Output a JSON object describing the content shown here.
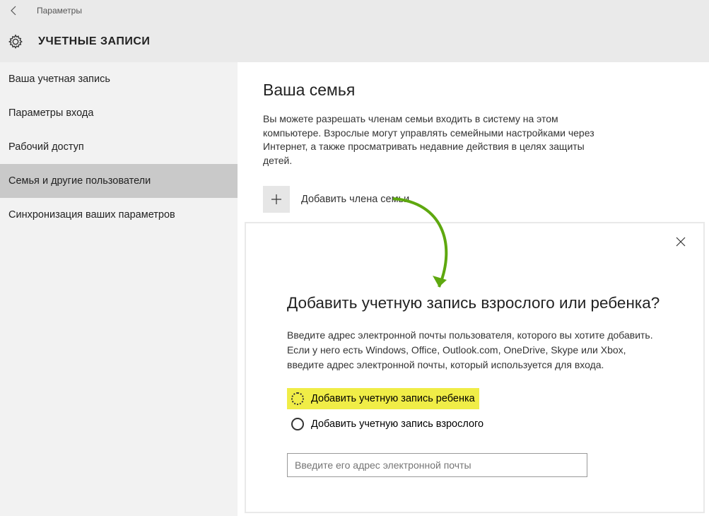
{
  "titlebar": {
    "label": "Параметры"
  },
  "header": {
    "title": "УЧЕТНЫЕ ЗАПИСИ"
  },
  "sidebar": {
    "items": [
      {
        "label": "Ваша учетная запись",
        "selected": false
      },
      {
        "label": "Параметры входа",
        "selected": false
      },
      {
        "label": "Рабочий доступ",
        "selected": false
      },
      {
        "label": "Семья и другие пользователи",
        "selected": true
      },
      {
        "label": "Синхронизация ваших параметров",
        "selected": false
      }
    ]
  },
  "main": {
    "section_title": "Ваша семья",
    "section_desc": "Вы можете разрешать членам семьи входить в систему на этом компьютере. Взрослые могут управлять семейными настройками через Интернет, а также просматривать недавние действия в целях защиты детей.",
    "add_label": "Добавить члена семьи"
  },
  "dialog": {
    "title": "Добавить учетную запись взрослого или ребенка?",
    "desc": "Введите адрес электронной почты пользователя, которого вы хотите добавить. Если у него есть Windows, Office, Outlook.com, OneDrive, Skype или Xbox, введите адрес электронной почты, который используется для входа.",
    "option_child": "Добавить учетную запись ребенка",
    "option_adult": "Добавить учетную запись взрослого",
    "email_placeholder": "Введите его адрес электронной почты"
  }
}
